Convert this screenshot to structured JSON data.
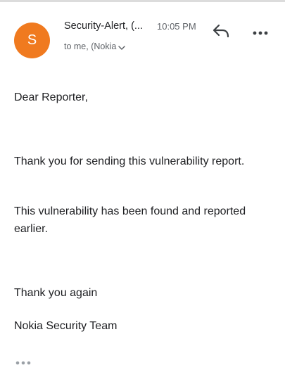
{
  "email": {
    "avatar_initial": "S",
    "sender": "Security-Alert, (...",
    "time": "10:05 PM",
    "recipient": "to me, (Nokia",
    "body": {
      "greeting": "Dear Reporter,",
      "paragraph_1": "Thank you for sending this vulnerability report.",
      "paragraph_2": "This vulnerability has been found and reported earlier.",
      "closing": "Thank you again",
      "signature": "Nokia Security Team"
    }
  },
  "icons": {
    "reply": "reply-icon",
    "more": "more-options-icon",
    "expand_recipients": "chevron-down-icon",
    "show_quoted": "show-trimmed-content-icon"
  },
  "colors": {
    "avatar_background": "#f07a1f",
    "text": "#202124",
    "secondary_text": "#5f6368"
  }
}
